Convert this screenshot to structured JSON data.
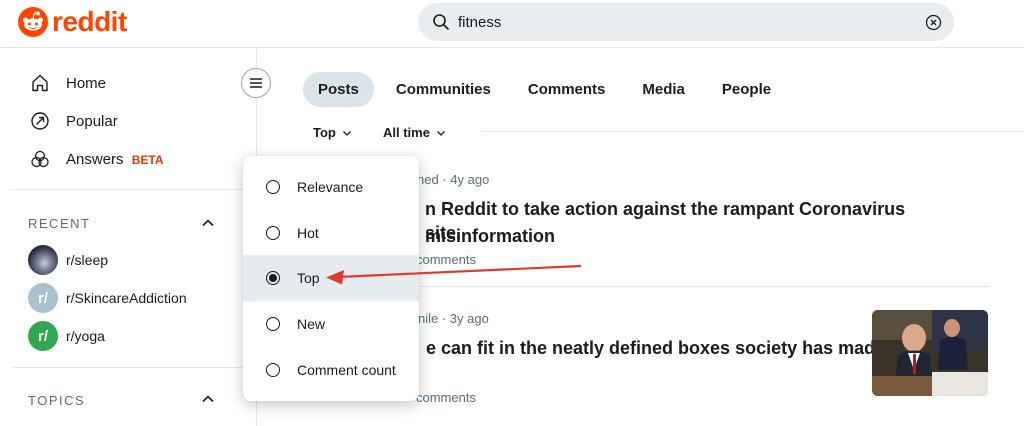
{
  "header": {
    "brand": "reddit",
    "brand_color": "#ff4500",
    "search": {
      "value": "fitness",
      "icon": "search-icon",
      "clear_icon": "clear-circle-icon"
    }
  },
  "sidebar": {
    "nav": [
      {
        "label": "Home",
        "icon": "home-icon"
      },
      {
        "label": "Popular",
        "icon": "popular-arrow-icon"
      },
      {
        "label": "Answers",
        "icon": "answers-icon",
        "badge": "BETA"
      }
    ],
    "recent": {
      "title": "RECENT",
      "items": [
        {
          "label": "r/sleep"
        },
        {
          "label": "r/SkincareAddiction",
          "avatar_glyph": "r/"
        },
        {
          "label": "r/yoga",
          "avatar_glyph": "r/"
        }
      ]
    },
    "topics": {
      "title": "TOPICS"
    }
  },
  "search_results": {
    "tabs": [
      {
        "label": "Posts",
        "active": true
      },
      {
        "label": "Communities"
      },
      {
        "label": "Comments"
      },
      {
        "label": "Media"
      },
      {
        "label": "People"
      }
    ],
    "sort": {
      "label": "Top"
    },
    "time": {
      "label": "All time"
    },
    "sort_menu": {
      "options": [
        {
          "label": "Relevance",
          "selected": false
        },
        {
          "label": "Hot",
          "selected": false
        },
        {
          "label": "Top",
          "selected": true
        },
        {
          "label": "New",
          "selected": false
        },
        {
          "label": "Comment count",
          "selected": false
        }
      ]
    },
    "posts": [
      {
        "meta_visible": "ned · 4y ago",
        "title_line1": "n Reddit to take action against the rampant Coronavirus misinformation",
        "title_line2": "site.",
        "stats_visible": "comments"
      },
      {
        "meta_visible": "nile · 3y ago",
        "title_line1": "e can fit in the neatly defined boxes society has made",
        "stats_visible": "comments"
      }
    ]
  },
  "annotation_arrow": {
    "color": "#e03a2f"
  }
}
